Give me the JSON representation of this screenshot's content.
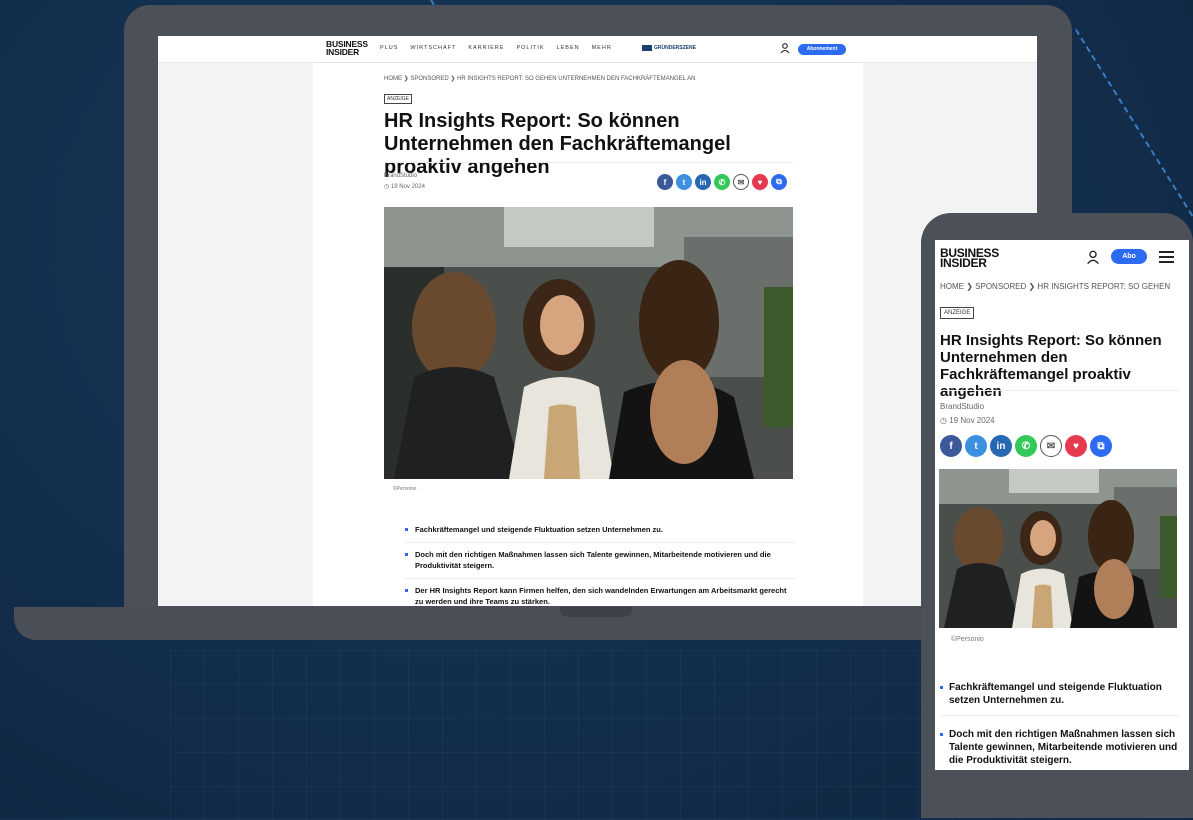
{
  "site": {
    "logo_line1": "BUSINESS",
    "logo_line2": "INSIDER",
    "nav": [
      "PLUS",
      "WIRTSCHAFT",
      "KARRIERE",
      "POLITIK",
      "LEBEN",
      "MEHR"
    ],
    "gruenderszene": "GRÜNDERSZENE",
    "subscribe_desktop": "Abonnement",
    "subscribe_mobile": "Abo"
  },
  "desktop": {
    "breadcrumb": "HOME  ❯  SPONSORED  ❯  HR INSIGHTS REPORT: SO GEHEN UNTERNEHMEN DEN FACHKRÄFTEMANGEL AN",
    "caption": "©Personio"
  },
  "mobile": {
    "breadcrumb": "HOME  ❯  SPONSORED  ❯  HR INSIGHTS REPORT: SO GEHEN",
    "caption": "©Personio"
  },
  "article": {
    "badge": "ANZEIGE",
    "title": "HR Insights Report: So können Unternehmen den Fachkräftemangel proaktiv angehen",
    "author": "BrandStudio",
    "date": "19 Nov 2024",
    "bullets": [
      "Fachkräftemangel und steigende Fluktuation setzen Unternehmen zu.",
      "Doch mit den richtigen Maßnahmen lassen sich Talente gewinnen, Mitarbeitende motivieren und die Produktivität steigern.",
      "Der HR Insights Report kann Firmen helfen, den sich wandelnden Erwartungen am Arbeitsmarkt gerecht zu werden und ihre Teams zu stärken."
    ]
  },
  "share_buttons": [
    {
      "name": "facebook-icon",
      "glyph": "f",
      "color": "#3b5998"
    },
    {
      "name": "twitter-icon",
      "glyph": "t",
      "color": "#3d8fe0"
    },
    {
      "name": "linkedin-icon",
      "glyph": "in",
      "color": "#2867b2"
    },
    {
      "name": "whatsapp-icon",
      "glyph": "✆",
      "color": "#34c759"
    },
    {
      "name": "email-icon",
      "glyph": "✉",
      "color": "#ffffff"
    },
    {
      "name": "pocket-icon",
      "glyph": "♥",
      "color": "#e63950"
    },
    {
      "name": "copy-link-icon",
      "glyph": "⧉",
      "color": "#2c6bf0"
    }
  ],
  "colors": {
    "accent": "#2c6bf0",
    "device": "#4c5159",
    "background": "#14304f"
  }
}
